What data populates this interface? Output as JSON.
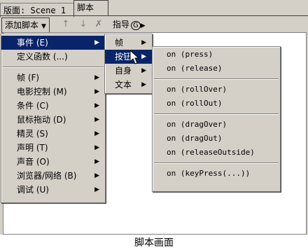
{
  "tabs": {
    "scene": "版面: Scene 1",
    "script": "脚本"
  },
  "toolbar": {
    "add_script": "添加脚本",
    "guide": "指导",
    "guide_key": "G"
  },
  "menu_main": [
    {
      "label": "事件 (E)",
      "selected": true,
      "submenu": true
    },
    {
      "label": "定义函数 (...)",
      "selected": false,
      "submenu": false
    },
    {
      "label": "帧 (F)",
      "selected": false,
      "submenu": true
    },
    {
      "label": "电影控制 (M)",
      "selected": false,
      "submenu": true
    },
    {
      "label": "条件 (C)",
      "selected": false,
      "submenu": true
    },
    {
      "label": "鼠标拖动 (D)",
      "selected": false,
      "submenu": true
    },
    {
      "label": "精灵 (S)",
      "selected": false,
      "submenu": true
    },
    {
      "label": "声明 (T)",
      "selected": false,
      "submenu": true
    },
    {
      "label": "声音 (O)",
      "selected": false,
      "submenu": true
    },
    {
      "label": "浏览器/网络 (B)",
      "selected": false,
      "submenu": true
    },
    {
      "label": "调试 (U)",
      "selected": false,
      "submenu": true
    }
  ],
  "menu_events": [
    {
      "label": "帧",
      "selected": false
    },
    {
      "label": "按钮",
      "selected": true
    },
    {
      "label": "自身",
      "selected": false
    },
    {
      "label": "文本",
      "selected": false
    }
  ],
  "menu_button": [
    "on (press)",
    "on (release)",
    "on (rollOver)",
    "on (rollOut)",
    "on (dragOver)",
    "on (dragOut)",
    "on (releaseOutside)",
    "on (keyPress(...))"
  ],
  "caption": "脚本画面"
}
